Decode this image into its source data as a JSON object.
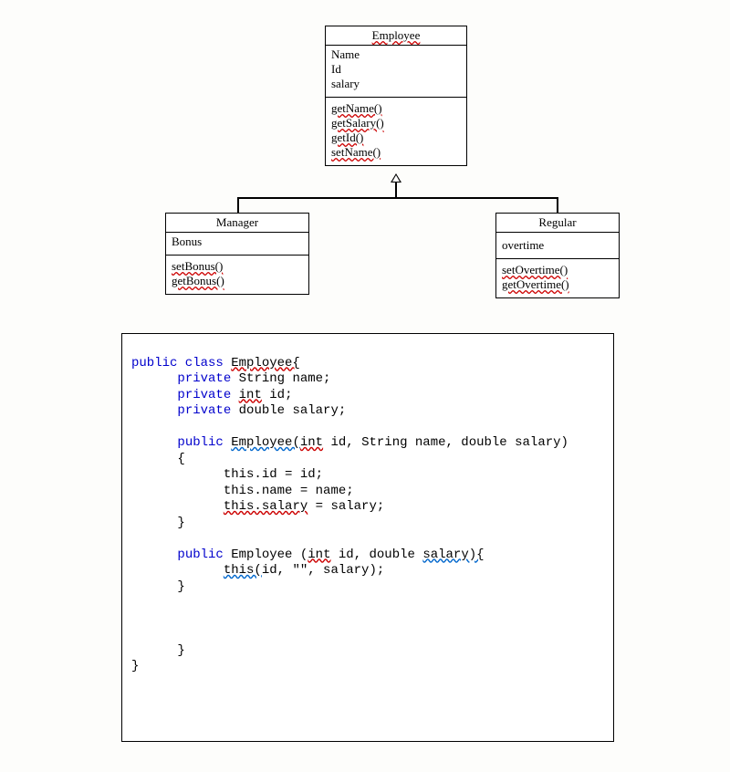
{
  "diagram": {
    "employee": {
      "title": "Employee",
      "attrs": [
        "Name",
        "Id",
        "salary"
      ],
      "ops": [
        "getName()",
        "getSalary()",
        "getId()",
        "setName()"
      ]
    },
    "manager": {
      "title": "Manager",
      "attrs": [
        "Bonus"
      ],
      "ops": [
        "setBonus()",
        "getBonus()"
      ]
    },
    "regular": {
      "title": "Regular",
      "attrs": [
        "overtime"
      ],
      "ops": [
        "setOvertime()",
        "getOvertime()"
      ]
    }
  },
  "code": {
    "l1a": "public class ",
    "l1b": "Employee{",
    "l2a": "private",
    "l2b": " String name;",
    "l3a": "private ",
    "l3b": "int",
    "l3c": " id;",
    "l4a": "private",
    "l4b": " double salary;",
    "l5a": "public ",
    "l5b": "Employee(",
    "l5c": "int",
    "l5d": " id, String name, double salary)",
    "l6": "{",
    "l7": "this.id = id;",
    "l8": "this.name = name;",
    "l9a": "this.salary",
    "l9b": " = salary;",
    "l10": "}",
    "l11a": "public",
    "l11b": " Employee (",
    "l11c": "int",
    "l11d": " id, double ",
    "l11e": "salary){",
    "l12a": "this(",
    "l12b": "id, \"\", salary);",
    "l13": "}",
    "l14": "}",
    "l15": "}"
  }
}
